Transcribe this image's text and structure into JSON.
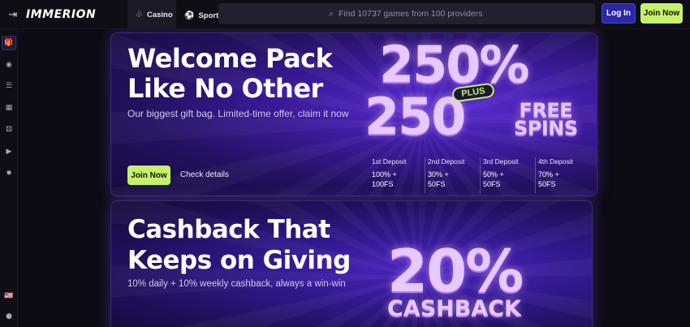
{
  "header": {
    "logo": "IMMERION",
    "collapse_icon": "⇥",
    "tabs": [
      {
        "label": "Casino",
        "icon": "♧"
      },
      {
        "label": "Sport",
        "icon": "⚽"
      }
    ],
    "search_placeholder": "Find 10737 games from 100 providers",
    "login_label": "Log In",
    "join_label": "Join Now"
  },
  "sidebar": {
    "icons": [
      "gift-icon",
      "coins-icon",
      "list-icon",
      "grid-icon",
      "dice-icon",
      "play-icon",
      "sun-icon"
    ],
    "flag": "🇺🇸",
    "chat": "●"
  },
  "banner1": {
    "title_line1": "Welcome Pack",
    "title_line2": "Like No Other",
    "subtitle": "Our biggest gift bag. Limited-time offer, claim it now",
    "join_label": "Join Now",
    "details_label": "Check details",
    "percent": "250%",
    "plus": "PLUS",
    "spins_number": "250",
    "free_line1": "FREE",
    "free_line2": "SPINS",
    "deposits": [
      {
        "title": "1st Deposit",
        "line1": "100% +",
        "line2": "100FS"
      },
      {
        "title": "2nd Deposit",
        "line1": "30% +",
        "line2": "50FS"
      },
      {
        "title": "3rd Deposit",
        "line1": "50% +",
        "line2": "50FS"
      },
      {
        "title": "4th Deposit",
        "line1": "70% +",
        "line2": "50FS"
      }
    ]
  },
  "banner2": {
    "title_line1": "Cashback That",
    "title_line2": "Keeps on Giving",
    "subtitle": "10% daily + 10% weekly cashback, always a win-win",
    "percent": "20%",
    "cashback": "CASHBACK"
  },
  "colors": {
    "accent": "#c6f26a",
    "login": "#2a28a6",
    "banner_purple": "#3b1a9a"
  }
}
